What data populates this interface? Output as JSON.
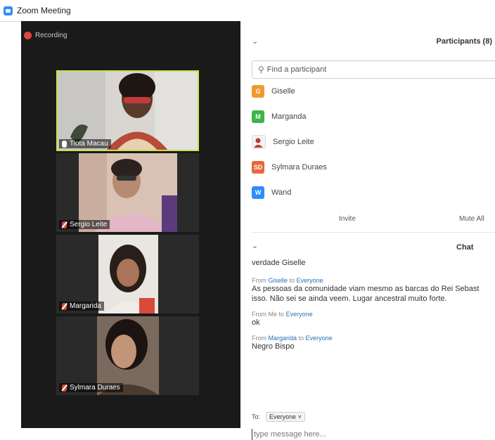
{
  "window": {
    "title": "Zoom Meeting"
  },
  "recording": {
    "label": "Recording",
    "color": "#e0483a"
  },
  "videos": [
    {
      "name": "Tiota Macau",
      "muted": false,
      "active": true
    },
    {
      "name": "Sergio Leite",
      "muted": true,
      "active": false
    },
    {
      "name": "Margarida",
      "muted": true,
      "active": false
    },
    {
      "name": "Sylmara Duraes",
      "muted": true,
      "active": false
    }
  ],
  "participants": {
    "title": "Participants (8)",
    "search_placeholder": "Find a participant",
    "list": [
      {
        "initial": "G",
        "name": "Giselle",
        "color": "#f29a2e"
      },
      {
        "initial": "M",
        "name": "Marganda",
        "color": "#3bb54a"
      },
      {
        "initial": "",
        "name": "Sergio Leite",
        "color": "#c0392b"
      },
      {
        "initial": "SD",
        "name": "Sylmara Duraes",
        "color": "#e8673c"
      },
      {
        "initial": "W",
        "name": "Wand",
        "color": "#2d8cff"
      }
    ],
    "invite_label": "Invite",
    "mute_all_label": "Mute All"
  },
  "chat": {
    "title": "Chat",
    "first_line": "verdade Giselle",
    "messages": [
      {
        "prefix": "From",
        "sender": "Giselle",
        "mid": "to",
        "target": "Everyone",
        "lines": [
          "As pessoas da comunidade viam mesmo as barcas do Rei Sebast",
          "isso. Não sei se ainda veem. Lugar ancestral muito forte."
        ]
      },
      {
        "prefix": "From",
        "sender": "Me",
        "mid": "to",
        "target": "Everyone",
        "lines": [
          "ok"
        ]
      },
      {
        "prefix": "From",
        "sender": "Margarida",
        "mid": "to",
        "target": "Everyone",
        "lines": [
          "Negro Bispo"
        ]
      }
    ],
    "to_label": "To:",
    "to_value": "Everyone",
    "input_placeholder": "type message here..."
  }
}
